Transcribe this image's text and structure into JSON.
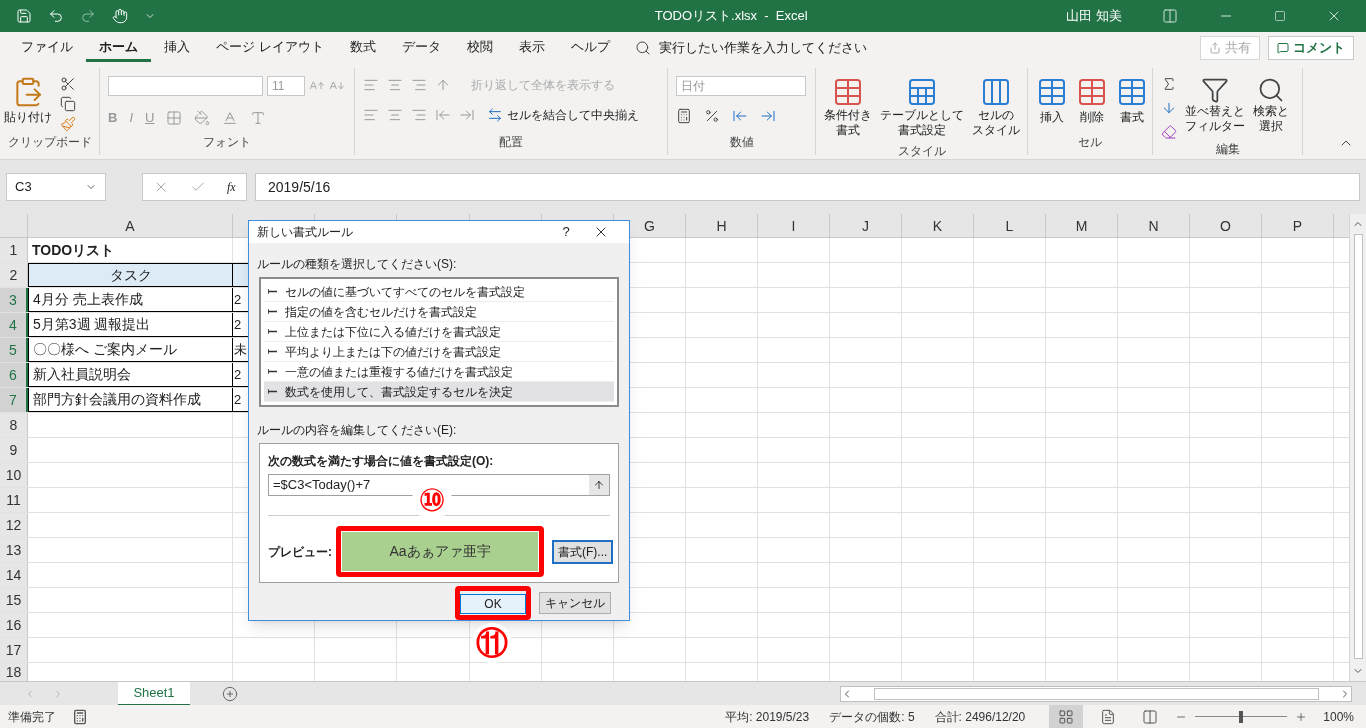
{
  "title_bar": {
    "file_title": "TODOリスト.xlsx  -  Excel",
    "user": "山田 知美"
  },
  "menu_tabs": [
    {
      "label": "ファイル",
      "selected": false
    },
    {
      "label": "ホーム",
      "selected": true
    },
    {
      "label": "挿入",
      "selected": false
    },
    {
      "label": "ページ レイアウト",
      "selected": false
    },
    {
      "label": "数式",
      "selected": false
    },
    {
      "label": "データ",
      "selected": false
    },
    {
      "label": "校閲",
      "selected": false
    },
    {
      "label": "表示",
      "selected": false
    },
    {
      "label": "ヘルプ",
      "selected": false
    }
  ],
  "tell_me": "実行したい作業を入力してください",
  "share_button": {
    "label": "共有",
    "disabled": true
  },
  "comment_button": "コメント",
  "ribbon": {
    "paste": "貼り付け",
    "clipboard_group": "クリップボード",
    "font_size": "11",
    "font_buttons": [
      "B",
      "I",
      "U"
    ],
    "font_group": "フォント",
    "wrap_text": "折り返して全体を表示する",
    "merge_center": "セルを結合して中央揃え",
    "alignment_group": "配置",
    "number_format": "日付",
    "number_group": "数値",
    "style_buttons": [
      {
        "line1": "条件付き",
        "line2": "書式"
      },
      {
        "line1": "テーブルとして",
        "line2": "書式設定"
      },
      {
        "line1": "セルの",
        "line2": "スタイル"
      }
    ],
    "styles_group": "スタイル",
    "cell_buttons": [
      "挿入",
      "削除",
      "書式"
    ],
    "cells_group": "セル",
    "edit_buttons": [
      {
        "line1": "並べ替えと",
        "line2": "フィルター"
      },
      {
        "line1": "検索と",
        "line2": "選択"
      }
    ],
    "editing_group": "編集"
  },
  "formula_bar": {
    "name_box": "C3",
    "function_button": "fx",
    "formula": "2019/5/16"
  },
  "columns": [
    "A",
    "G",
    "H",
    "I",
    "J",
    "K",
    "L",
    "M",
    "N",
    "O",
    "P"
  ],
  "rows": [
    {
      "header": "1",
      "selected": false,
      "kind": "title",
      "a": "TODOリスト"
    },
    {
      "header": "2",
      "selected": false,
      "kind": "heading",
      "a": "タスク"
    },
    {
      "header": "3",
      "selected": true,
      "kind": "task",
      "a": "4月分 売上表作成",
      "b": "2"
    },
    {
      "header": "4",
      "selected": true,
      "kind": "task",
      "a": "5月第3週 週報提出",
      "b": "2"
    },
    {
      "header": "5",
      "selected": true,
      "kind": "task",
      "a": "〇〇様へ ご案内メール",
      "b": "未"
    },
    {
      "header": "6",
      "selected": true,
      "kind": "task",
      "a": "新入社員説明会",
      "b": "2"
    },
    {
      "header": "7",
      "selected": true,
      "kind": "task",
      "a": "部門方針会議用の資料作成",
      "b": "2"
    },
    {
      "header": "8",
      "selected": false,
      "kind": "blank"
    },
    {
      "header": "9",
      "selected": false,
      "kind": "blank"
    },
    {
      "header": "10",
      "selected": false,
      "kind": "blank"
    },
    {
      "header": "11",
      "selected": false,
      "kind": "blank"
    },
    {
      "header": "12",
      "selected": false,
      "kind": "blank"
    },
    {
      "header": "13",
      "selected": false,
      "kind": "blank"
    },
    {
      "header": "14",
      "selected": false,
      "kind": "blank"
    },
    {
      "header": "15",
      "selected": false,
      "kind": "blank"
    },
    {
      "header": "16",
      "selected": false,
      "kind": "blank"
    },
    {
      "header": "17",
      "selected": false,
      "kind": "blank"
    },
    {
      "header": "18",
      "selected": false,
      "kind": "blank"
    }
  ],
  "dialog": {
    "title": "新しい書式ルール",
    "help": "?",
    "type_label": "ルールの種類を選択してください(S):",
    "rule_types": [
      {
        "label": "セルの値に基づいてすべてのセルを書式設定",
        "selected": false
      },
      {
        "label": "指定の値を含むセルだけを書式設定",
        "selected": false
      },
      {
        "label": "上位または下位に入る値だけを書式設定",
        "selected": false
      },
      {
        "label": "平均より上または下の値だけを書式設定",
        "selected": false
      },
      {
        "label": "一意の値または重複する値だけを書式設定",
        "selected": false
      },
      {
        "label": "数式を使用して、書式設定するセルを決定",
        "selected": true
      }
    ],
    "edit_label": "ルールの内容を編集してください(E):",
    "formula_label": "次の数式を満たす場合に値を書式設定(O):",
    "formula": "=$C3<Today()+7",
    "preview_label": "プレビュー:",
    "preview_text": "Aaあぁアァ亜宇",
    "format_button": "書式(F)...",
    "ok_button": "OK",
    "cancel_button": "キャンセル"
  },
  "annotations": [
    "⑩",
    "⑪"
  ],
  "sheet_tabs": [
    {
      "label": "Sheet1",
      "selected": true
    }
  ],
  "status_bar": {
    "status": "準備完了",
    "average": "平均: 2019/5/23",
    "count": "データの個数: 5",
    "sum": "合計: 2496/12/20",
    "views": [
      {
        "kind": "normal",
        "selected": true
      },
      {
        "kind": "page_layout",
        "selected": false
      },
      {
        "kind": "page_break",
        "selected": false
      }
    ],
    "zoom": "100%",
    "zoom_slider": {
      "level": 0.5
    }
  }
}
